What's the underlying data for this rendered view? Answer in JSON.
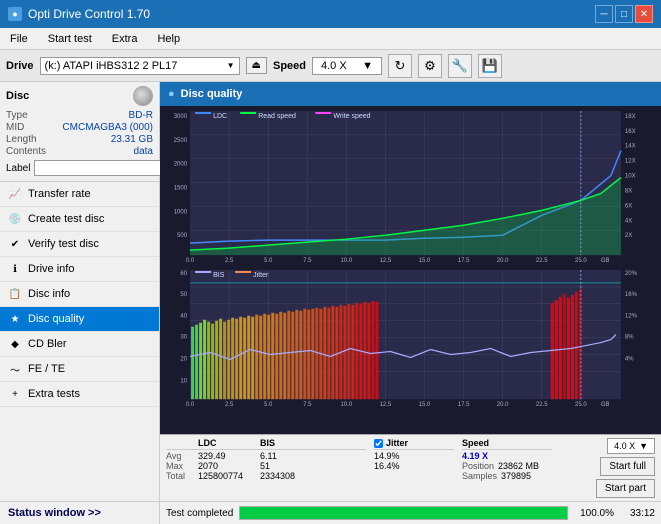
{
  "app": {
    "title": "Opti Drive Control 1.70",
    "icon": "●"
  },
  "titlebar": {
    "title": "Opti Drive Control 1.70",
    "minimize_label": "─",
    "restore_label": "□",
    "close_label": "✕"
  },
  "menubar": {
    "items": [
      "File",
      "Start test",
      "Extra",
      "Help"
    ]
  },
  "drivebar": {
    "drive_label": "Drive",
    "drive_value": "(k:) ATAPI iHBS312  2 PL17",
    "speed_label": "Speed",
    "speed_value": "4.0 X"
  },
  "disc": {
    "title": "Disc",
    "type_label": "Type",
    "type_value": "BD-R",
    "mid_label": "MID",
    "mid_value": "CMCMAGBA3 (000)",
    "length_label": "Length",
    "length_value": "23.31 GB",
    "contents_label": "Contents",
    "contents_value": "data",
    "label_label": "Label",
    "label_value": ""
  },
  "chart": {
    "title": "Disc quality",
    "legend": {
      "ldc": "LDC",
      "read": "Read speed",
      "write": "Write speed"
    },
    "y_axis_left_max": 3000,
    "y_axis_right_labels": [
      "18X",
      "16X",
      "14X",
      "12X",
      "10X",
      "8X",
      "6X",
      "4X",
      "2X"
    ],
    "x_axis_labels": [
      "0.0",
      "2.5",
      "5.0",
      "7.5",
      "10.0",
      "12.5",
      "15.0",
      "17.5",
      "20.0",
      "22.5",
      "25.0"
    ],
    "x_axis_unit": "GB",
    "bis_legend": {
      "bis": "BIS",
      "jitter": "Jitter"
    },
    "bis_y_max": 60,
    "bis_y_right_labels": [
      "20%",
      "16%",
      "12%",
      "8%",
      "4%"
    ]
  },
  "stats": {
    "ldc_label": "LDC",
    "bis_label": "BIS",
    "jitter_label": "Jitter",
    "speed_label": "Speed",
    "position_label": "Position",
    "samples_label": "Samples",
    "avg_label": "Avg",
    "max_label": "Max",
    "total_label": "Total",
    "ldc_avg": "329.49",
    "ldc_max": "2070",
    "ldc_total": "125800774",
    "bis_avg": "6.11",
    "bis_max": "51",
    "bis_total": "2334308",
    "jitter_avg": "14.9%",
    "jitter_max": "16.4%",
    "jitter_total": "",
    "speed_value": "4.19 X",
    "speed_set": "4.0 X",
    "position_value": "23862 MB",
    "samples_value": "379895"
  },
  "buttons": {
    "start_full_label": "Start full",
    "start_part_label": "Start part"
  },
  "progress": {
    "percent": "100.0%",
    "time": "33:12",
    "status": "Test completed"
  },
  "sidebar_nav": [
    {
      "id": "transfer-rate",
      "label": "Transfer rate",
      "icon": "📈"
    },
    {
      "id": "create-test-disc",
      "label": "Create test disc",
      "icon": "💿"
    },
    {
      "id": "verify-test-disc",
      "label": "Verify test disc",
      "icon": "✔"
    },
    {
      "id": "drive-info",
      "label": "Drive info",
      "icon": "ℹ"
    },
    {
      "id": "disc-info",
      "label": "Disc info",
      "icon": "📋"
    },
    {
      "id": "disc-quality",
      "label": "Disc quality",
      "icon": "★",
      "active": true
    },
    {
      "id": "cd-bler",
      "label": "CD Bler",
      "icon": "◆"
    },
    {
      "id": "fe-te",
      "label": "FE / TE",
      "icon": "〜"
    },
    {
      "id": "extra-tests",
      "label": "Extra tests",
      "icon": "+"
    }
  ],
  "status_window": {
    "label": "Status window >> "
  }
}
